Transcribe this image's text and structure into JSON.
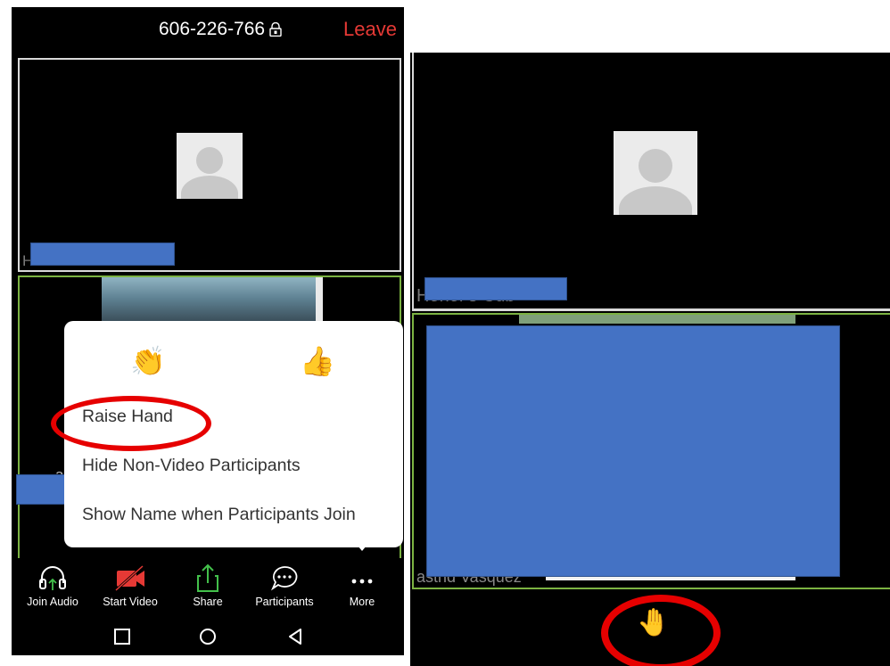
{
  "left": {
    "meeting_id": "606-226-766",
    "leave_label": "Leave",
    "tile_a_name": "Honor's Cub",
    "tile_b_name": "astrid",
    "menu": {
      "reaction_clap": "👏",
      "reaction_thumbs": "👍",
      "items": [
        "Raise Hand",
        "Hide Non-Video Participants",
        "Show Name when Participants Join"
      ]
    },
    "toolbar": [
      {
        "label": "Join Audio",
        "icon": "headphones-icon"
      },
      {
        "label": "Start Video",
        "icon": "video-off-icon"
      },
      {
        "label": "Share",
        "icon": "share-icon"
      },
      {
        "label": "Participants",
        "icon": "chat-bubble-icon"
      },
      {
        "label": "More",
        "icon": "more-dots-icon"
      }
    ]
  },
  "right": {
    "tile_c_name": "Honor's Cub",
    "tile_d_name": "astrid Vasquez",
    "raised_hand": "🤚"
  },
  "colors": {
    "leave_red": "#e53935",
    "active_border": "#7cb342",
    "redaction_blue": "#4472c4",
    "highlight_ring": "#e60000",
    "share_green": "#43c04b",
    "video_off_red": "#e53935"
  }
}
